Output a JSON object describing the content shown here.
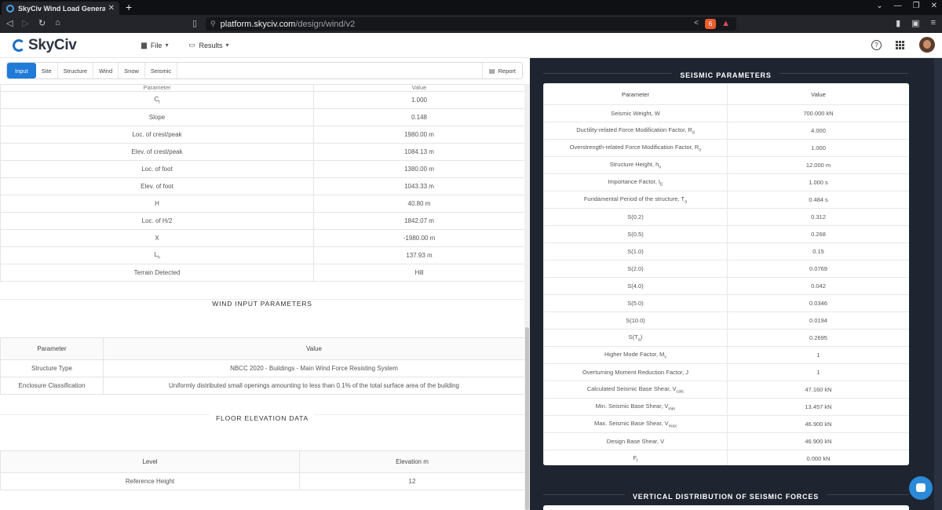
{
  "browser": {
    "tab_title": "SkyCiv Wind Load Generator |",
    "url_host": "platform.skyciv.com",
    "url_path": "/design/wind/v2",
    "brave_badge": "6"
  },
  "app": {
    "logo": "SkyCiv",
    "menu_file": "File",
    "menu_results": "Results"
  },
  "tabs": [
    "Input",
    "Site",
    "Structure",
    "Wind",
    "Snow",
    "Seismic"
  ],
  "report_label": "Report",
  "site_table": {
    "header": [
      "Parameter",
      "Value"
    ],
    "rows": [
      {
        "p": "C",
        "sub": "t",
        "v": "1.000"
      },
      {
        "p": "Slope",
        "sub": "",
        "v": "0.148"
      },
      {
        "p": "Loc. of crest/peak",
        "sub": "",
        "v": "1980.00 m"
      },
      {
        "p": "Elev. of crest/peak",
        "sub": "",
        "v": "1084.13 m"
      },
      {
        "p": "Loc. of foot",
        "sub": "",
        "v": "1380.00 m"
      },
      {
        "p": "Elev. of foot",
        "sub": "",
        "v": "1043.33 m"
      },
      {
        "p": "H",
        "sub": "",
        "v": "40.80 m"
      },
      {
        "p": "Loc. of H/2",
        "sub": "",
        "v": "1842.07 m"
      },
      {
        "p": "X",
        "sub": "",
        "v": "-1980.00 m"
      },
      {
        "p": "L",
        "sub": "h",
        "v": "137.93 m"
      },
      {
        "p": "Terrain Detected",
        "sub": "",
        "v": "Hill"
      }
    ]
  },
  "wind_input": {
    "title": "WIND INPUT PARAMETERS",
    "header": [
      "Parameter",
      "Value"
    ],
    "rows": [
      {
        "p": "Structure Type",
        "v": "NBCC 2020 - Buildings - Main Wind Force Resisting System"
      },
      {
        "p": "Enclosure Classification",
        "v": "Uniformly distributed small openings amounting to less than 0.1% of the total surface area of the building"
      }
    ]
  },
  "floor_elev": {
    "title": "FLOOR ELEVATION DATA",
    "header": [
      "Level",
      "Elevation m"
    ],
    "rows": [
      {
        "p": "Reference Height",
        "v": "12"
      }
    ]
  },
  "seismic": {
    "title": "SEISMIC PARAMETERS",
    "header": [
      "Parameter",
      "Value"
    ],
    "rows": [
      {
        "p": "Seismic Weight, W",
        "sub": "",
        "v": "700.000 kN"
      },
      {
        "p": "Ductility-related Force Modification Factor, R",
        "sub": "d",
        "v": "4.000"
      },
      {
        "p": "Overstrength-related Force Modification Factor, R",
        "sub": "o",
        "v": "1.000"
      },
      {
        "p": "Structure Height, h",
        "sub": "n",
        "v": "12.000 m"
      },
      {
        "p": "Importance Factor, I",
        "sub": "E",
        "v": "1.000 s"
      },
      {
        "p": "Fundamental Period of the structure, T",
        "sub": "a",
        "v": "0.484 s"
      },
      {
        "p": "S(0.2)",
        "sub": "",
        "v": "0.312"
      },
      {
        "p": "S(0.5)",
        "sub": "",
        "v": "0.268"
      },
      {
        "p": "S(1.0)",
        "sub": "",
        "v": "0.15"
      },
      {
        "p": "S(2.0)",
        "sub": "",
        "v": "0.0769"
      },
      {
        "p": "S(4.0)",
        "sub": "",
        "v": "0.042"
      },
      {
        "p": "S(5.0)",
        "sub": "",
        "v": "0.0346"
      },
      {
        "p": "S(10.0)",
        "sub": "",
        "v": "0.0194"
      },
      {
        "p": "S(T",
        "sub": "a",
        "post": ")",
        "v": "0.2695"
      },
      {
        "p": "Higher Mode Factor, M",
        "sub": "v",
        "v": "1"
      },
      {
        "p": "Overturning Moment Reduction Factor, J",
        "sub": "",
        "v": "1"
      },
      {
        "p": "Calculated Seismic Base Shear, V",
        "sub": "calc",
        "v": "47.160 kN"
      },
      {
        "p": "Min. Seismic Base Shear, V",
        "sub": "min",
        "v": "13.457 kN"
      },
      {
        "p": "Max. Seismic Base Shear, V",
        "sub": "max",
        "v": "46.900 kN"
      },
      {
        "p": "Design Base Shear, V",
        "sub": "",
        "v": "46.900 kN"
      },
      {
        "p": "F",
        "sub": "t",
        "v": "0.000 kN"
      }
    ]
  },
  "vertical_dist_title": "VERTICAL DISTRIBUTION OF SEISMIC FORCES"
}
